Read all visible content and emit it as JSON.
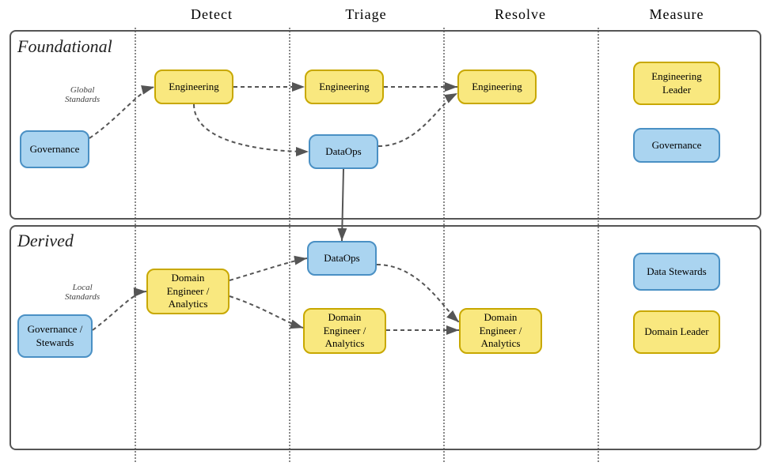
{
  "headers": {
    "detect": "Detect",
    "triage": "Triage",
    "resolve": "Resolve",
    "measure": "Measure"
  },
  "sections": {
    "foundational": "Foundational",
    "derived": "Derived"
  },
  "labels": {
    "global_standards": "Global\nStandards",
    "local_standards": "Local\nStandards"
  },
  "nodes": {
    "f_governance": "Governance",
    "f_eng_detect": "Engineering",
    "f_eng_triage": "Engineering",
    "f_dataops_triage": "DataOps",
    "f_eng_resolve": "Engineering",
    "f_eng_leader": "Engineering\nLeader",
    "f_governance_measure": "Governance",
    "d_governance_stewards": "Governance\n/ Stewards",
    "d_domain_eng_detect": "Domain\nEngineer /\nAnalytics",
    "d_dataops_triage": "DataOps",
    "d_domain_eng_triage": "Domain\nEngineer /\nAnalytics",
    "d_domain_eng_resolve": "Domain\nEngineer /\nAnalytics",
    "d_data_stewards": "Data\nStewards",
    "d_domain_leader": "Domain\nLeader"
  }
}
